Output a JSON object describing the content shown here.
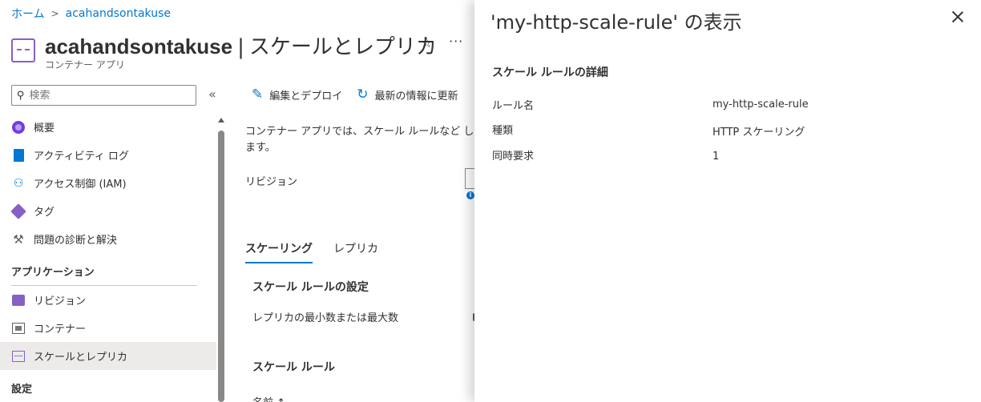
{
  "breadcrumb": {
    "home": "ホーム",
    "current": "acahandsontakuse"
  },
  "header": {
    "resource_name": "acahandsontakuse",
    "divider": "|",
    "page_name": "スケールとレプリカ",
    "subtitle": "コンテナー アプリ",
    "favorite_icon": "☆",
    "more_icon": "···"
  },
  "sidebar": {
    "search_placeholder": "検索",
    "collapse_icon": "«",
    "items_top": [
      {
        "label": "概要",
        "icon": "overview-icon"
      },
      {
        "label": "アクティビティ ログ",
        "icon": "activity-log-icon"
      },
      {
        "label": "アクセス制御 (IAM)",
        "icon": "iam-icon"
      },
      {
        "label": "タグ",
        "icon": "tag-icon"
      },
      {
        "label": "問題の診断と解決",
        "icon": "wrench-icon"
      }
    ],
    "section_application": "アプリケーション",
    "items_app": [
      {
        "label": "リビジョン",
        "icon": "revision-icon"
      },
      {
        "label": "コンテナー",
        "icon": "container-icon"
      },
      {
        "label": "スケールとレプリカ",
        "icon": "scale-icon"
      }
    ],
    "section_settings": "設定"
  },
  "toolbar": {
    "edit_deploy": "編集とデプロイ",
    "refresh": "最新の情報に更新"
  },
  "main": {
    "description": "コンテナー アプリでは、スケール ルールなど します。",
    "revision_label": "リビジョン",
    "tabs": [
      "スケーリング",
      "レプリカ"
    ],
    "scale_rule_settings": "スケール ルールの設定",
    "replica_minmax": "レプリカの最小数または最大数",
    "scale_rules": "スケール ルール",
    "column_name": "名前 ↑"
  },
  "panel": {
    "title": "'my-http-scale-rule' の表示",
    "details_heading": "スケール ルールの詳細",
    "rows": [
      {
        "key": "ルール名",
        "value": "my-http-scale-rule"
      },
      {
        "key": "種類",
        "value": "HTTP スケーリング"
      },
      {
        "key": "同時要求",
        "value": "1"
      }
    ]
  },
  "colors": {
    "accent": "#0078d4",
    "container_app": "#8661c5"
  }
}
